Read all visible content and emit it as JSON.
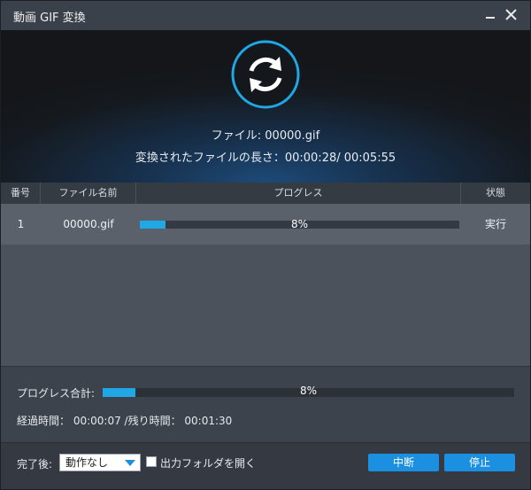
{
  "window": {
    "title": "動画 GIF 変換"
  },
  "hero": {
    "file_line": "ファイル: 00000.gif",
    "length_line": "変換されたファイルの長さ：00:00:28/ 00:05:55"
  },
  "table": {
    "headers": {
      "no": "番号",
      "name": "ファイル名前",
      "progress": "プログレス",
      "state": "状態"
    },
    "rows": [
      {
        "no": "1",
        "name": "00000.gif",
        "progress_text": "8%",
        "progress": 0.08,
        "state": "実行"
      }
    ]
  },
  "summary": {
    "label": "プログレス合計:",
    "progress_text": "8%",
    "progress": 0.08,
    "time_line": "経過時間： 00:00:07 /残り時間： 00:01:30"
  },
  "footer": {
    "after_label": "完了後:",
    "after_select": "動作なし",
    "open_folder_label": "出力フォルダを開く",
    "pause_label": "中断",
    "stop_label": "停止"
  },
  "colors": {
    "accent": "#1fa7e6",
    "button": "#1b8fe0"
  },
  "icons": {
    "convert": "refresh-icon",
    "minimize": "minimize-icon",
    "close": "close-icon"
  }
}
